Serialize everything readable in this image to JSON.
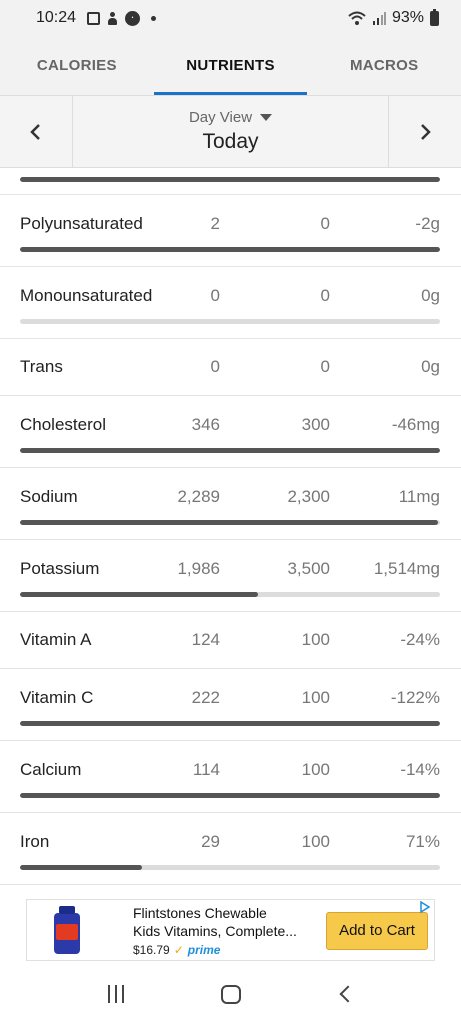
{
  "status_bar": {
    "time": "10:24",
    "battery": "93%",
    "icons": [
      "image-icon",
      "person-icon",
      "app-badge-icon",
      "notification-dot-icon",
      "wifi-icon",
      "signal-icon",
      "battery-icon"
    ]
  },
  "tabs": [
    {
      "label": "CALORIES",
      "active": false
    },
    {
      "label": "NUTRIENTS",
      "active": true
    },
    {
      "label": "MACROS",
      "active": false
    }
  ],
  "day_nav": {
    "view_label": "Day View",
    "day": "Today"
  },
  "nutrients": [
    {
      "name": "Polyunsaturated",
      "total": "2",
      "goal": "0",
      "left": "-2g",
      "progress": 1.0
    },
    {
      "name": "Monounsaturated",
      "total": "0",
      "goal": "0",
      "left": "0g",
      "progress": 0.0
    },
    {
      "name": "Trans",
      "total": "0",
      "goal": "0",
      "left": "0g",
      "progress": null
    },
    {
      "name": "Cholesterol",
      "total": "346",
      "goal": "300",
      "left": "-46mg",
      "progress": 1.0
    },
    {
      "name": "Sodium",
      "total": "2,289",
      "goal": "2,300",
      "left": "11mg",
      "progress": 0.995
    },
    {
      "name": "Potassium",
      "total": "1,986",
      "goal": "3,500",
      "left": "1,514mg",
      "progress": 0.567
    },
    {
      "name": "Vitamin A",
      "total": "124",
      "goal": "100",
      "left": "-24%",
      "progress": null
    },
    {
      "name": "Vitamin C",
      "total": "222",
      "goal": "100",
      "left": "-122%",
      "progress": 1.0
    },
    {
      "name": "Calcium",
      "total": "114",
      "goal": "100",
      "left": "-14%",
      "progress": 1.0
    },
    {
      "name": "Iron",
      "total": "29",
      "goal": "100",
      "left": "71%",
      "progress": 0.29
    }
  ],
  "ad": {
    "title_line1": "Flintstones Chewable",
    "title_line2": "Kids Vitamins, Complete...",
    "price": "$16.79",
    "prime": "prime",
    "button": "Add to Cart",
    "colors": {
      "button": "#f7c94b",
      "prime": "#1f8fd9"
    }
  },
  "colors": {
    "accent": "#1a73c8",
    "bar_fill": "#555555",
    "bar_track": "#dcdcdc"
  }
}
